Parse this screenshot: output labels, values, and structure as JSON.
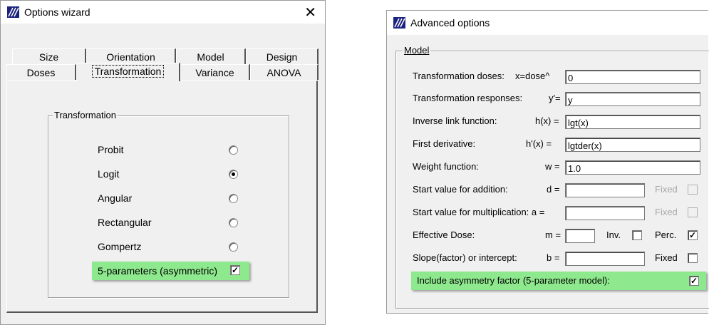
{
  "wizard": {
    "title": "Options wizard",
    "tabs_row1": [
      "Size",
      "Orientation",
      "Model",
      "Design"
    ],
    "tabs_row2": [
      "Doses",
      "Transformation",
      "Variance",
      "ANOVA"
    ],
    "active_tab": "Transformation",
    "group_title": "Transformation",
    "options": [
      {
        "label": "Probit",
        "selected": false
      },
      {
        "label": "Logit",
        "selected": true
      },
      {
        "label": "Angular",
        "selected": false
      },
      {
        "label": "Rectangular",
        "selected": false
      },
      {
        "label": "Gompertz",
        "selected": false
      }
    ],
    "five_param_label": "5-parameters (asymmetric)",
    "five_param_checked": true
  },
  "advanced": {
    "title": "Advanced options",
    "group_title": "Model",
    "rows": {
      "transform_doses": {
        "label": "Transformation doses:",
        "var": "x=dose^",
        "value": "0"
      },
      "transform_responses": {
        "label": "Transformation responses:",
        "var": "y'=",
        "value": "y"
      },
      "inverse_link": {
        "label": "Inverse link function:",
        "var": "h(x) =",
        "value": "lgt(x)"
      },
      "first_derivative": {
        "label": "First derivative:",
        "var": "h'(x) =",
        "value": "lgtder(x)"
      },
      "weight": {
        "label": "Weight function:",
        "var": "w =",
        "value": "1.0"
      },
      "start_add": {
        "label": "Start value for addition:",
        "var": "d =",
        "value": "",
        "fixed": "Fixed"
      },
      "start_mult": {
        "label": "Start value for multiplication: a =",
        "value": "",
        "fixed": "Fixed"
      },
      "effective_dose": {
        "label": "Effective Dose:",
        "var": "m =",
        "value": "",
        "inv": "Inv.",
        "perc": "Perc."
      },
      "slope": {
        "label": "Slope(factor) or intercept:",
        "var": "b =",
        "value": "",
        "fixed": "Fixed"
      }
    },
    "asymmetry_label": "Include asymmetry factor (5-parameter model):",
    "asymmetry_checked": true
  },
  "colors": {
    "highlight": "#8ee88e",
    "background": "#f0f0f0"
  },
  "icons": {
    "app": "wizard-app-icon",
    "close": "close-icon"
  }
}
